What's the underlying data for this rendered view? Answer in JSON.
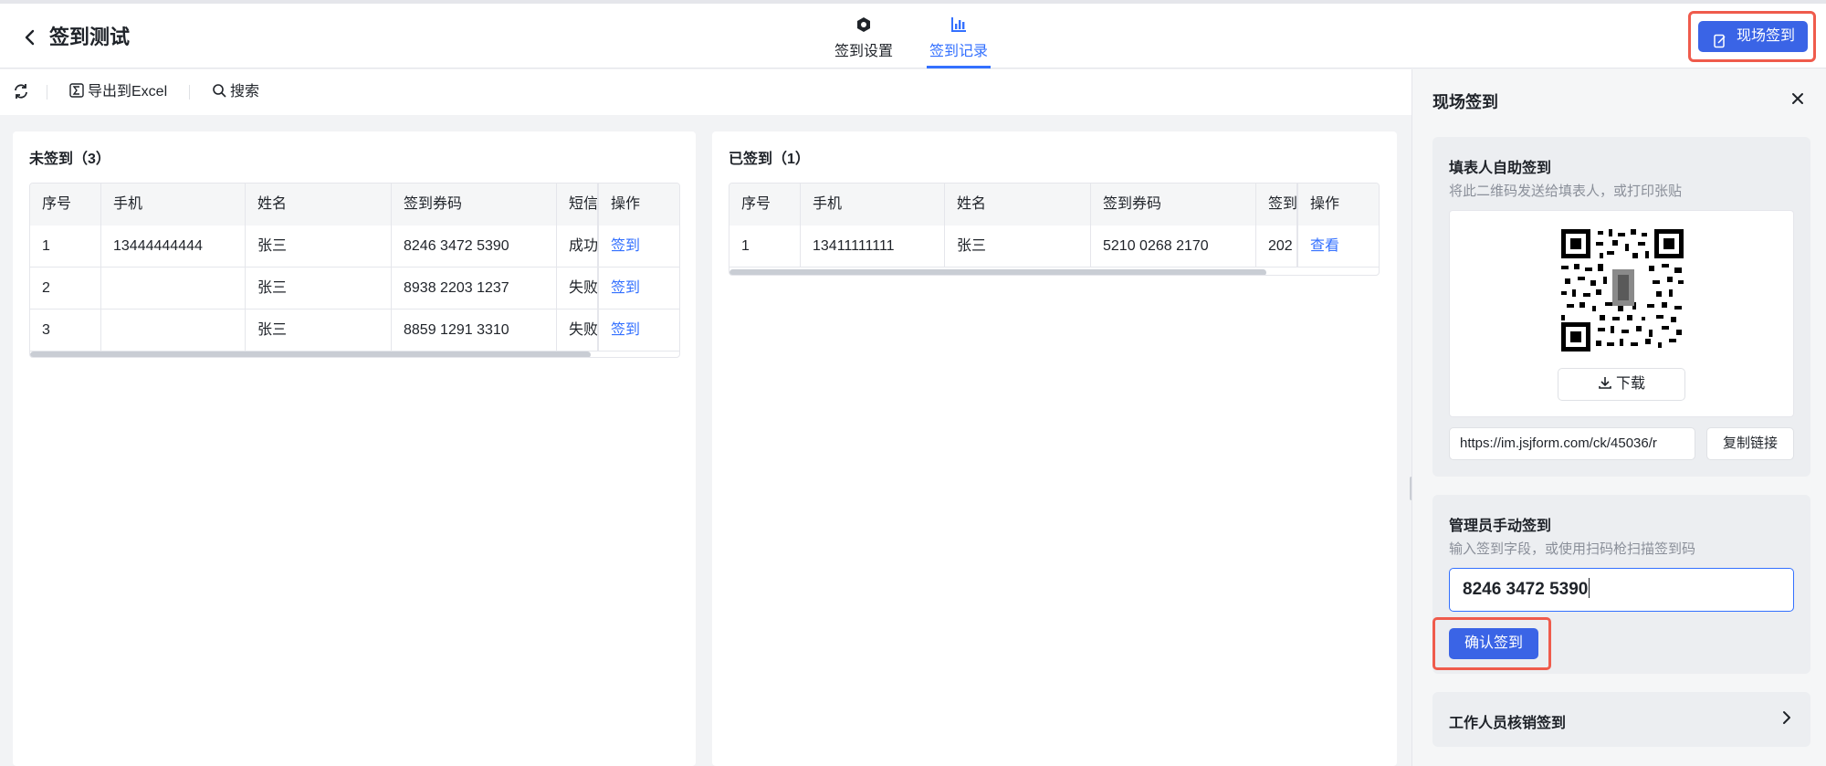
{
  "header": {
    "back_icon": "chevron-left-icon",
    "title": "签到测试",
    "tabs": [
      {
        "label": "签到设置",
        "icon": "hexagon-settings-icon",
        "active": false
      },
      {
        "label": "签到记录",
        "icon": "bar-chart-icon",
        "active": true
      }
    ],
    "live_button_label": "现场签到",
    "accent_color": "#3370ff",
    "highlight_color": "#ef5b4c"
  },
  "toolbar": {
    "refresh_icon": "refresh-icon",
    "export_label": "导出到Excel",
    "search_label": "搜索"
  },
  "unsigned": {
    "title": "未签到（3）",
    "columns": [
      "序号",
      "手机",
      "姓名",
      "签到券码",
      "短信",
      "操作"
    ],
    "rows": [
      {
        "no": "1",
        "phone": "13444444444",
        "name": "张三",
        "code": "8246 3472 5390",
        "sms": "成功",
        "action": "签到"
      },
      {
        "no": "2",
        "phone": "",
        "name": "张三",
        "code": "8938 2203 1237",
        "sms": "失败",
        "action": "签到"
      },
      {
        "no": "3",
        "phone": "",
        "name": "张三",
        "code": "8859 1291 3310",
        "sms": "失败",
        "action": "签到"
      }
    ]
  },
  "signed": {
    "title": "已签到（1）",
    "columns": [
      "序号",
      "手机",
      "姓名",
      "签到券码",
      "签到",
      "操作"
    ],
    "rows": [
      {
        "no": "1",
        "phone": "13411111111",
        "name": "张三",
        "code": "5210 0268 2170",
        "time": "202",
        "action": "查看"
      }
    ]
  },
  "side_panel": {
    "title": "现场签到",
    "self": {
      "title": "填表人自助签到",
      "subtitle": "将此二维码发送给填表人，或打印张贴",
      "download_label": "下载",
      "url": "https://im.jsjform.com/ck/45036/r",
      "copy_label": "复制链接"
    },
    "admin": {
      "title": "管理员手动签到",
      "subtitle": "输入签到字段，或使用扫码枪扫描签到码",
      "input_value": "8246 3472 5390",
      "confirm_label": "确认签到"
    },
    "staff": {
      "title": "工作人员核销签到"
    }
  }
}
